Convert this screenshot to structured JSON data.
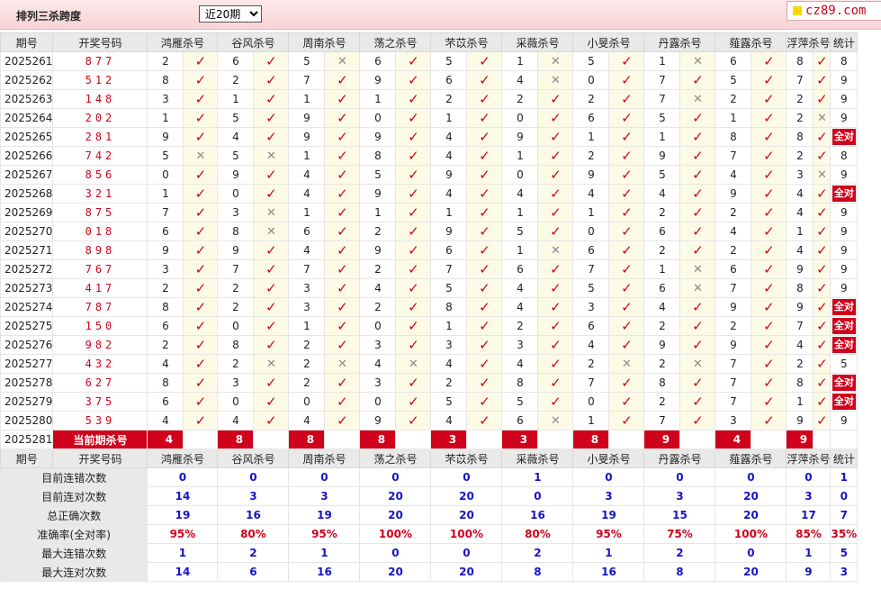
{
  "header": {
    "title": "排列三杀跨度",
    "period_selected": "近20期",
    "logo": "cz89.com"
  },
  "columns": {
    "period": "期号",
    "winning": "开奖号码",
    "count": "统计"
  },
  "experts": [
    "鸿雁杀号",
    "谷风杀号",
    "周南杀号",
    "荡之杀号",
    "芣苡杀号",
    "采薇杀号",
    "小旻杀号",
    "丹露杀号",
    "薤露杀号",
    "浮萍杀号"
  ],
  "rows": [
    {
      "p": "2025261",
      "n": "877",
      "k": [
        2,
        6,
        5,
        6,
        5,
        1,
        5,
        1,
        6,
        8
      ],
      "m": "1101101011",
      "c": "8"
    },
    {
      "p": "2025262",
      "n": "512",
      "k": [
        8,
        2,
        7,
        9,
        6,
        4,
        0,
        7,
        5,
        7
      ],
      "m": "1111101111",
      "c": "9"
    },
    {
      "p": "2025263",
      "n": "148",
      "k": [
        3,
        1,
        1,
        1,
        2,
        2,
        2,
        7,
        2,
        2
      ],
      "m": "1111111011",
      "c": "9"
    },
    {
      "p": "2025264",
      "n": "202",
      "k": [
        1,
        5,
        9,
        0,
        1,
        0,
        6,
        5,
        1,
        2
      ],
      "m": "1111111110",
      "c": "9"
    },
    {
      "p": "2025265",
      "n": "281",
      "k": [
        9,
        4,
        9,
        9,
        4,
        9,
        1,
        1,
        8,
        8
      ],
      "m": "1111111111",
      "c": "全对"
    },
    {
      "p": "2025266",
      "n": "742",
      "k": [
        5,
        5,
        1,
        8,
        4,
        1,
        2,
        9,
        7,
        2
      ],
      "m": "0011111111",
      "c": "8"
    },
    {
      "p": "2025267",
      "n": "856",
      "k": [
        0,
        9,
        4,
        5,
        9,
        0,
        9,
        5,
        4,
        3
      ],
      "m": "1111111110",
      "c": "9"
    },
    {
      "p": "2025268",
      "n": "321",
      "k": [
        1,
        0,
        4,
        9,
        4,
        4,
        4,
        4,
        9,
        4
      ],
      "m": "1111111111",
      "c": "全对"
    },
    {
      "p": "2025269",
      "n": "875",
      "k": [
        7,
        3,
        1,
        1,
        1,
        1,
        1,
        2,
        2,
        4
      ],
      "m": "1011111111",
      "c": "9"
    },
    {
      "p": "2025270",
      "n": "018",
      "k": [
        6,
        8,
        6,
        2,
        9,
        5,
        0,
        6,
        4,
        1
      ],
      "m": "1011111111",
      "c": "9"
    },
    {
      "p": "2025271",
      "n": "898",
      "k": [
        9,
        9,
        4,
        9,
        6,
        1,
        6,
        2,
        2,
        4
      ],
      "m": "1111101111",
      "c": "9"
    },
    {
      "p": "2025272",
      "n": "767",
      "k": [
        3,
        7,
        7,
        2,
        7,
        6,
        7,
        1,
        6,
        9
      ],
      "m": "1111111011",
      "c": "9"
    },
    {
      "p": "2025273",
      "n": "417",
      "k": [
        2,
        2,
        3,
        4,
        5,
        4,
        5,
        6,
        7,
        8
      ],
      "m": "1111111011",
      "c": "9"
    },
    {
      "p": "2025274",
      "n": "787",
      "k": [
        8,
        2,
        3,
        2,
        8,
        4,
        3,
        4,
        9,
        9
      ],
      "m": "1111111111",
      "c": "全对"
    },
    {
      "p": "2025275",
      "n": "150",
      "k": [
        6,
        0,
        1,
        0,
        1,
        2,
        6,
        2,
        2,
        7
      ],
      "m": "1111111111",
      "c": "全对"
    },
    {
      "p": "2025276",
      "n": "982",
      "k": [
        2,
        8,
        2,
        3,
        3,
        3,
        4,
        9,
        9,
        4
      ],
      "m": "1111111111",
      "c": "全对"
    },
    {
      "p": "2025277",
      "n": "432",
      "k": [
        4,
        2,
        2,
        4,
        4,
        4,
        2,
        2,
        7,
        2
      ],
      "m": "1000110011",
      "c": "5"
    },
    {
      "p": "2025278",
      "n": "627",
      "k": [
        8,
        3,
        2,
        3,
        2,
        8,
        7,
        8,
        7,
        8
      ],
      "m": "1111111111",
      "c": "全对"
    },
    {
      "p": "2025279",
      "n": "375",
      "k": [
        6,
        0,
        0,
        0,
        5,
        5,
        0,
        2,
        7,
        1
      ],
      "m": "1111111111",
      "c": "全对"
    },
    {
      "p": "2025280",
      "n": "539",
      "k": [
        4,
        4,
        4,
        9,
        4,
        6,
        1,
        7,
        3,
        9
      ],
      "m": "1111101111",
      "c": "9"
    }
  ],
  "current": {
    "period": "2025281",
    "label": "当前期杀号",
    "kills": [
      "4",
      "8",
      "8",
      "8",
      "3",
      "3",
      "8",
      "9",
      "4",
      "9"
    ]
  },
  "stats": [
    {
      "label": "目前连错次数",
      "values": [
        "0",
        "0",
        "0",
        "0",
        "0",
        "1",
        "0",
        "0",
        "0",
        "0"
      ],
      "total": "1"
    },
    {
      "label": "目前连对次数",
      "values": [
        "14",
        "3",
        "3",
        "20",
        "20",
        "0",
        "3",
        "3",
        "20",
        "3"
      ],
      "total": "0"
    },
    {
      "label": "总正确次数",
      "values": [
        "19",
        "16",
        "19",
        "20",
        "20",
        "16",
        "19",
        "15",
        "20",
        "17"
      ],
      "total": "7"
    },
    {
      "label": "准确率(全对率)",
      "values": [
        "95%",
        "80%",
        "95%",
        "100%",
        "100%",
        "80%",
        "95%",
        "75%",
        "100%",
        "85%"
      ],
      "total": "35%"
    },
    {
      "label": "最大连错次数",
      "values": [
        "1",
        "2",
        "1",
        "0",
        "0",
        "2",
        "1",
        "2",
        "0",
        "1"
      ],
      "total": "5"
    },
    {
      "label": "最大连对次数",
      "values": [
        "14",
        "6",
        "16",
        "20",
        "20",
        "8",
        "16",
        "8",
        "20",
        "9"
      ],
      "total": "3"
    }
  ]
}
